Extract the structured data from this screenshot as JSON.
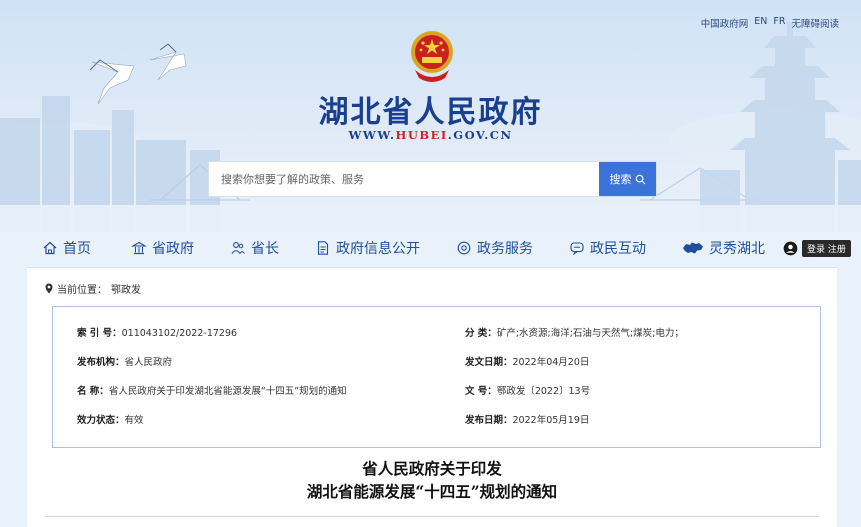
{
  "top_links": [
    "中国政府网",
    "EN",
    "FR",
    "无障碍阅读"
  ],
  "site": {
    "title": "湖北省人民政府",
    "url_prefix": "WWW.",
    "url_highlight": "HUBEI",
    "url_suffix": ".GOV.CN"
  },
  "search": {
    "placeholder": "搜索你想要了解的政策、服务",
    "button_label": "搜索"
  },
  "nav": {
    "items": [
      "首页",
      "省政府",
      "省长",
      "政府信息公开",
      "政务服务",
      "政民互动"
    ],
    "special": "灵秀湖北",
    "login_label": "登录 注册"
  },
  "breadcrumb": {
    "label": "当前位置：",
    "current": "鄂政发"
  },
  "meta": {
    "index_label": "索 引 号：",
    "index_value": "011043102/2022-17296",
    "category_label": "分 类：",
    "category_value": "矿产;水资源;海洋;石油与天然气;煤炭;电力；",
    "publisher_label": "发布机构：",
    "publisher_value": "省人民政府",
    "issue_date_label": "发文日期：",
    "issue_date_value": "2022年04月20日",
    "name_label": "名 称：",
    "name_value": "省人民政府关于印发湖北省能源发展“十四五”规划的通知",
    "doc_no_label": "文 号：",
    "doc_no_value": "鄂政发〔2022〕13号",
    "status_label": "效力状态：",
    "status_value": "有效",
    "publish_date_label": "发布日期：",
    "publish_date_value": "2022年05月19日"
  },
  "document": {
    "title_line1": "省人民政府关于印发",
    "title_line2": "湖北省能源发展“十四五”规划的通知"
  },
  "colors": {
    "brand_blue": "#1a3f8f",
    "nav_blue": "#1f4f9a",
    "search_button": "#3c73d8",
    "url_highlight": "#cc2222"
  }
}
